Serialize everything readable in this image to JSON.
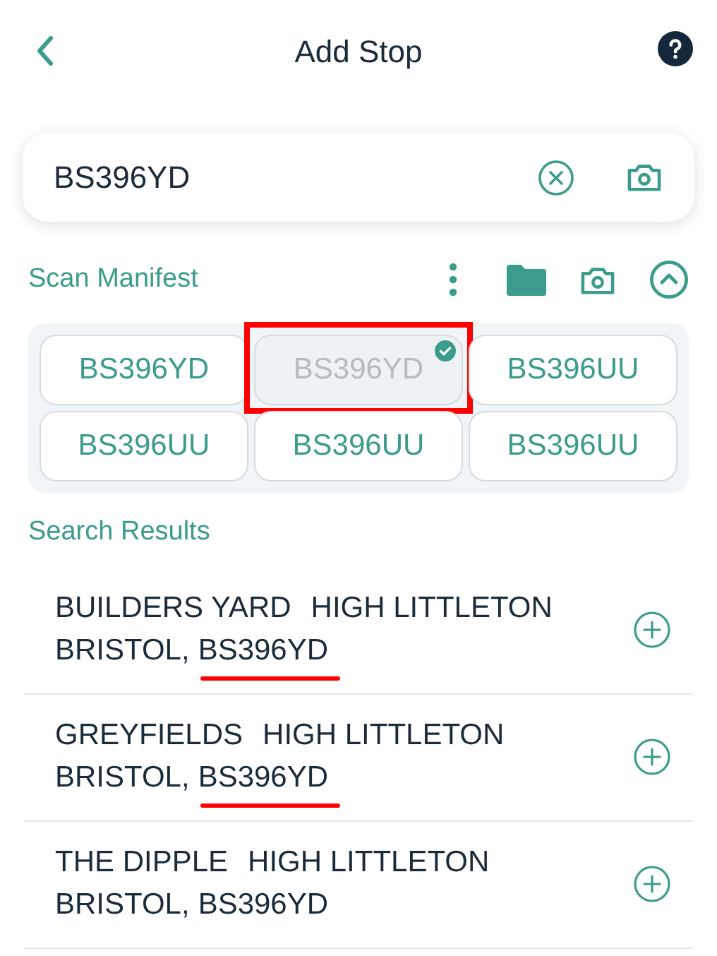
{
  "header": {
    "title": "Add Stop"
  },
  "search": {
    "value": "BS396YD"
  },
  "manifest": {
    "title": "Scan Manifest",
    "expanded": true,
    "chips": [
      {
        "label": "BS396YD",
        "selected": false,
        "highlighted": false
      },
      {
        "label": "BS396YD",
        "selected": true,
        "highlighted": true
      },
      {
        "label": "BS396UU",
        "selected": false,
        "highlighted": false
      },
      {
        "label": "BS396UU",
        "selected": false,
        "highlighted": false
      },
      {
        "label": "BS396UU",
        "selected": false,
        "highlighted": false
      },
      {
        "label": "BS396UU",
        "selected": false,
        "highlighted": false
      }
    ]
  },
  "results": {
    "title": "Search Results",
    "items": [
      {
        "name": "BUILDERS YARD",
        "locality": "HIGH LITTLETON",
        "city": "BRISTOL,",
        "postcode": "BS396YD",
        "underlined": true
      },
      {
        "name": "GREYFIELDS",
        "locality": "HIGH LITTLETON",
        "city": "BRISTOL,",
        "postcode": "BS396YD",
        "underlined": true
      },
      {
        "name": "THE DIPPLE",
        "locality": "HIGH LITTLETON",
        "city": "BRISTOL,",
        "postcode": "BS396YD",
        "underlined": false
      }
    ]
  }
}
